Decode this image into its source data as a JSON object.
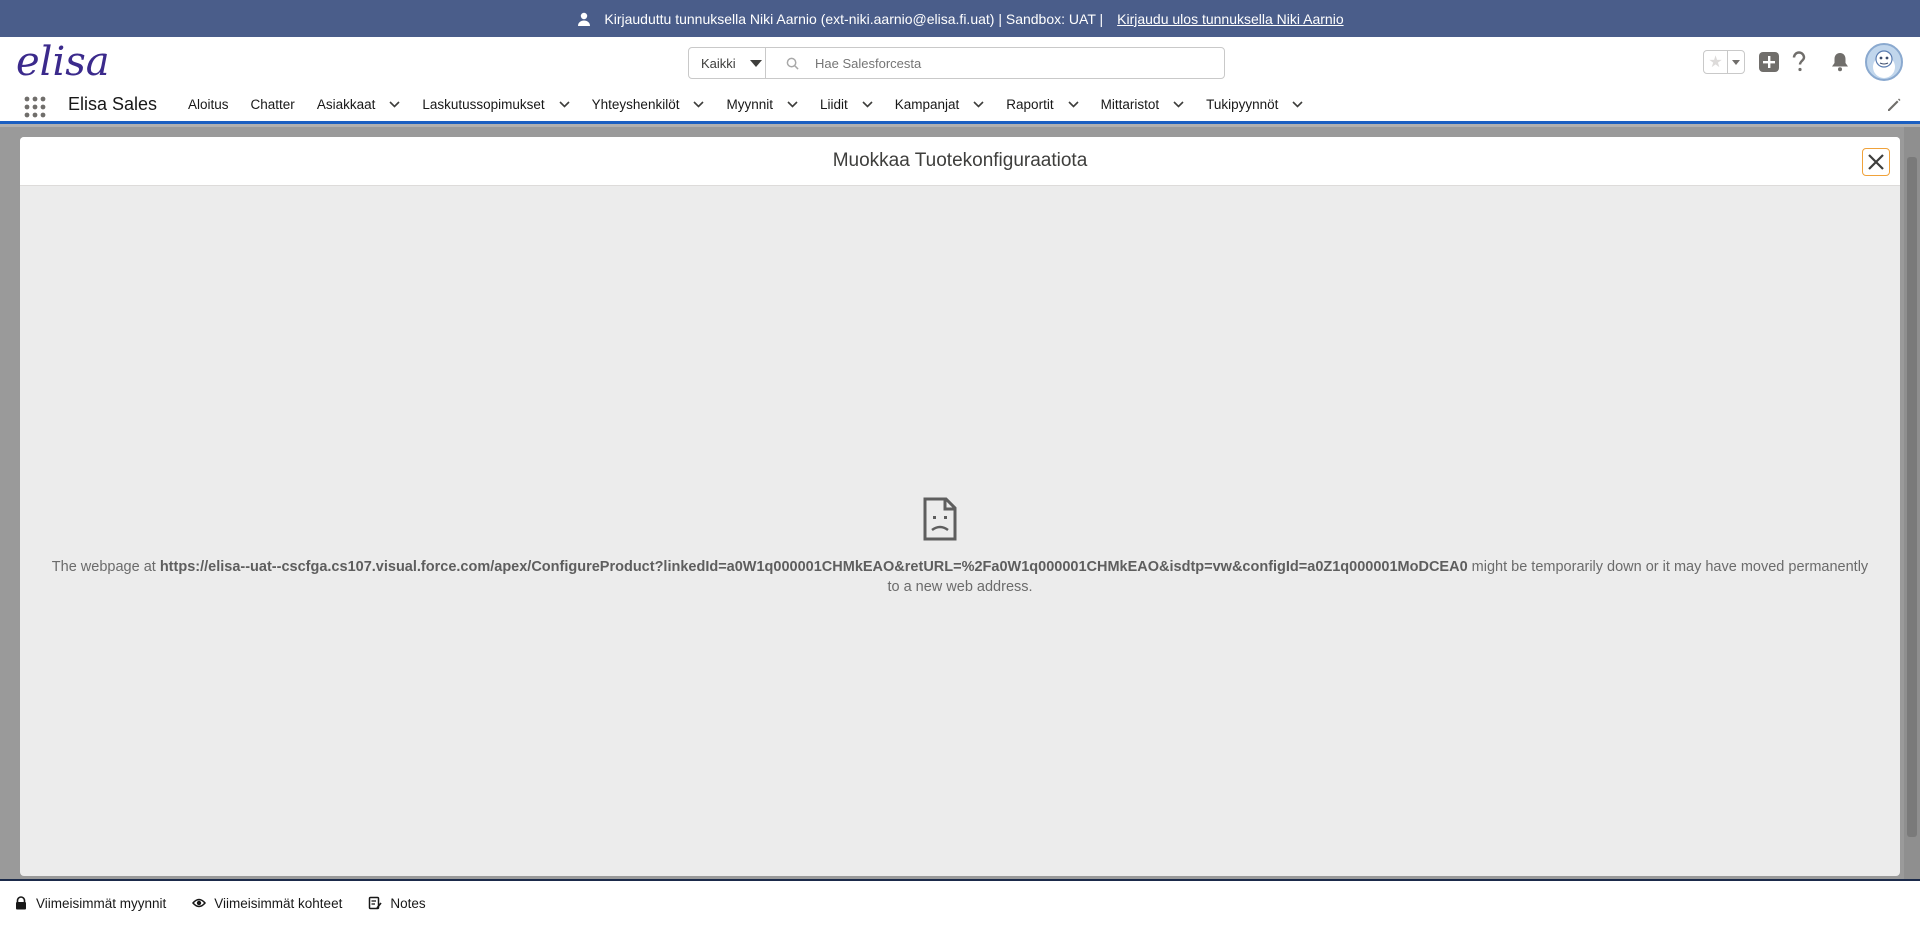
{
  "banner": {
    "text": "Kirjauduttu tunnuksella Niki Aarnio (ext-niki.aarnio@elisa.fi.uat) | Sandbox: UAT |",
    "logout_link": "Kirjaudu ulos tunnuksella Niki Aarnio"
  },
  "header": {
    "logo": "elisa",
    "search": {
      "scope": "Kaikki",
      "placeholder": "Hae Salesforcesta"
    }
  },
  "nav": {
    "app_name": "Elisa Sales",
    "items": [
      {
        "label": "Aloitus",
        "dropdown": false
      },
      {
        "label": "Chatter",
        "dropdown": false
      },
      {
        "label": "Asiakkaat",
        "dropdown": true
      },
      {
        "label": "Laskutussopimukset",
        "dropdown": true
      },
      {
        "label": "Yhteyshenkilöt",
        "dropdown": true
      },
      {
        "label": "Myynnit",
        "dropdown": true
      },
      {
        "label": "Liidit",
        "dropdown": true
      },
      {
        "label": "Kampanjat",
        "dropdown": true
      },
      {
        "label": "Raportit",
        "dropdown": true
      },
      {
        "label": "Mittaristot",
        "dropdown": true
      },
      {
        "label": "Tukipyynnöt",
        "dropdown": true
      }
    ]
  },
  "modal": {
    "title": "Muokkaa Tuotekonfiguraatiota",
    "error_prefix": "The webpage at ",
    "error_url": "https://elisa--uat--cscfga.cs107.visual.force.com/apex/ConfigureProduct?linkedId=a0W1q000001CHMkEAO&retURL=%2Fa0W1q000001CHMkEAO&isdtp=vw&configId=a0Z1q000001MoDCEA0",
    "error_suffix": " might be temporarily down or it may have moved permanently to a new web address."
  },
  "utility_bar": {
    "items": [
      {
        "label": "Viimeisimmät myynnit",
        "icon": "lock-icon"
      },
      {
        "label": "Viimeisimmät kohteet",
        "icon": "eye-icon"
      },
      {
        "label": "Notes",
        "icon": "notes-icon"
      }
    ]
  },
  "colors": {
    "banner": "#4a5d8a",
    "nav_underline": "#1b5fc1",
    "logo": "#3b2a8c",
    "close_focus": "#f0a23a"
  }
}
